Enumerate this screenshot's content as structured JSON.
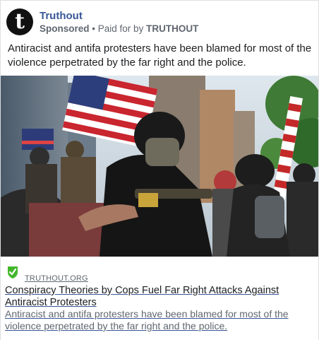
{
  "post": {
    "page_name": "Truthout",
    "avatar_letter": "t",
    "sponsored": "Sponsored",
    "separator": "•",
    "paid_for_prefix": "Paid for by",
    "payer": "TRUTHOUT",
    "message": "Antiracist and antifa protesters have been blamed for most of the violence perpetrated by the far right and the police."
  },
  "link": {
    "domain": "TRUTHOUT.ORG",
    "headline": "Conspiracy Theories by Cops Fuel Far Right Attacks Against Antiracist Protesters",
    "description": "Antiracist and antifa protesters have been blamed for most of the violence perpetrated by the far right and the police."
  },
  "colors": {
    "brand_link": "#385898",
    "verified_green": "#42b72a"
  },
  "icons": {
    "avatar": "truthout-logo-icon",
    "verified": "shield-check-icon"
  }
}
